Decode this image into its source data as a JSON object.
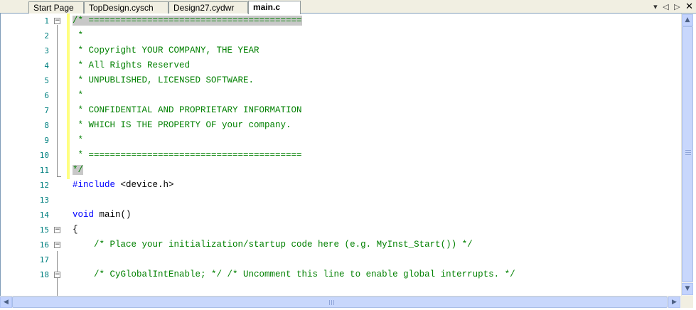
{
  "tabs": [
    {
      "label": "Start Page",
      "active": false
    },
    {
      "label": "TopDesign.cysch",
      "active": false
    },
    {
      "label": "Design27.cydwr",
      "active": false
    },
    {
      "label": "main.c",
      "active": true
    }
  ],
  "tab_controls": {
    "dropdown": "▾",
    "prev": "◁",
    "next": "▷",
    "close": "✕"
  },
  "editor": {
    "lines": [
      {
        "n": "1",
        "text": "/* ========================================"
      },
      {
        "n": "2",
        "text": " *"
      },
      {
        "n": "3",
        "text": " * Copyright YOUR COMPANY, THE YEAR"
      },
      {
        "n": "4",
        "text": " * All Rights Reserved"
      },
      {
        "n": "5",
        "text": " * UNPUBLISHED, LICENSED SOFTWARE."
      },
      {
        "n": "6",
        "text": " *"
      },
      {
        "n": "7",
        "text": " * CONFIDENTIAL AND PROPRIETARY INFORMATION"
      },
      {
        "n": "8",
        "text": " * WHICH IS THE PROPERTY OF your company."
      },
      {
        "n": "9",
        "text": " *"
      },
      {
        "n": "10",
        "text": " * ========================================"
      },
      {
        "n": "11",
        "text": "*/"
      },
      {
        "n": "12",
        "directive": "#include",
        "rest": " <device.h>"
      },
      {
        "n": "13",
        "text": ""
      },
      {
        "n": "14",
        "kw": "void",
        "rest": " main()"
      },
      {
        "n": "15",
        "text": "{"
      },
      {
        "n": "16",
        "text": "    /* Place your initialization/startup code here (e.g. MyInst_Start()) */"
      },
      {
        "n": "17",
        "text": ""
      },
      {
        "n": "18",
        "text": "    /* CyGlobalIntEnable; */ /* Uncomment this line to enable global interrupts. */"
      }
    ]
  },
  "scrollbars": {
    "up": "▲",
    "down": "▼",
    "left": "◀",
    "right": "▶"
  },
  "colors": {
    "comment": "#008000",
    "keyword": "#0000ff",
    "line_number": "#008080",
    "tab_background": "#f1efe2"
  }
}
